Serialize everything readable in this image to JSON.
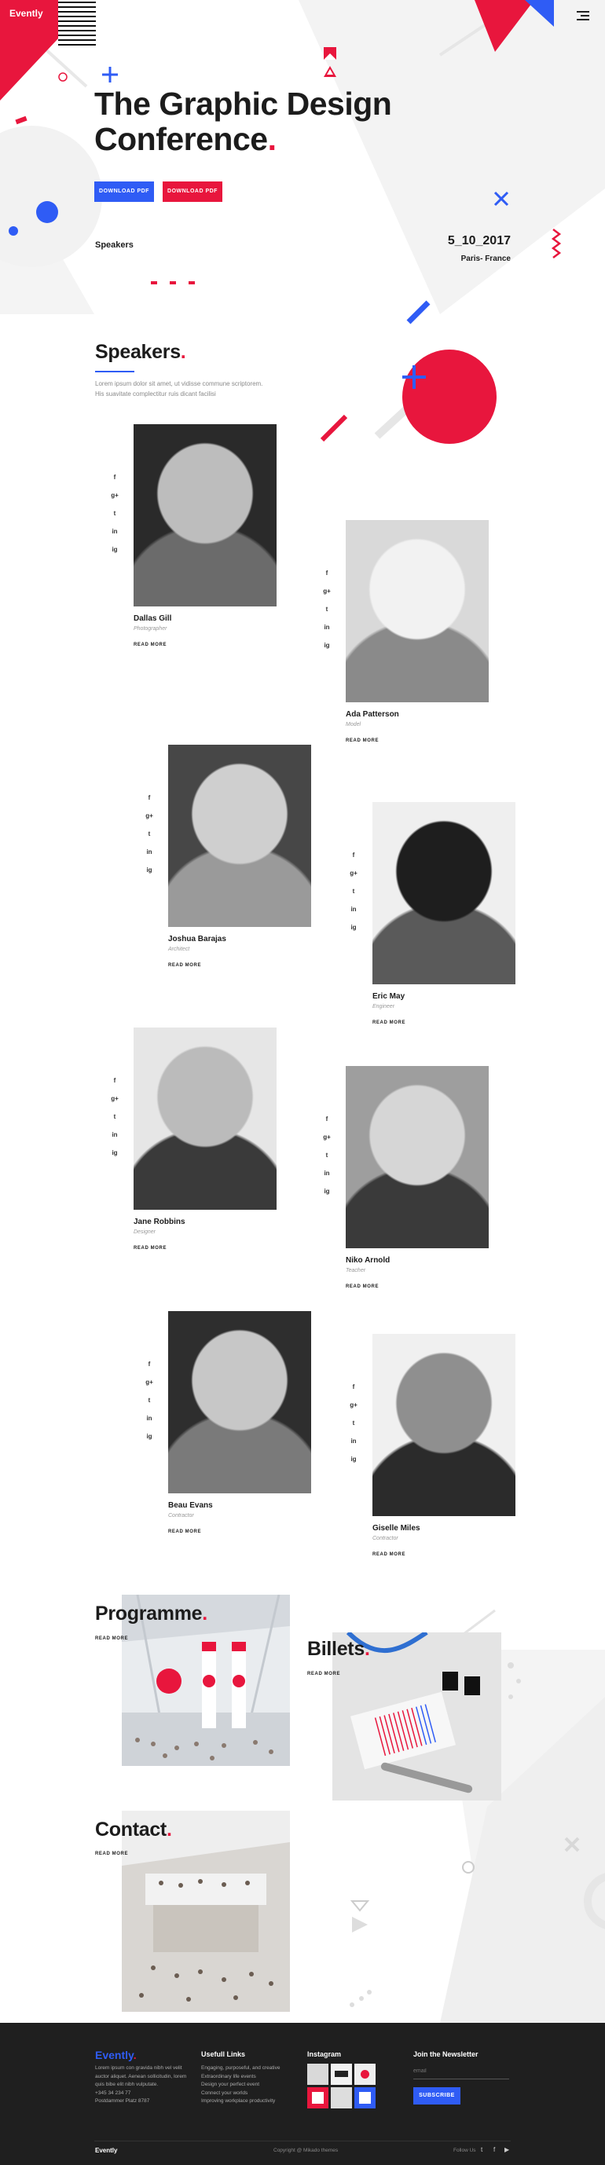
{
  "brand": {
    "logo": "Evently"
  },
  "hero": {
    "title_line1": "The Graphic Design",
    "title_line2": "Conference",
    "title_dot": ".",
    "btn_primary": "DOWNLOAD PDF",
    "btn_secondary": "DOWNLOAD PDF",
    "link": "Speakers",
    "date": "5_10_2017",
    "place": "Paris- France"
  },
  "speakers_section": {
    "title": "Speakers",
    "dot": ".",
    "text_line1": "Lorem ipsum dolor sit amet, ut vidisse commune scriptorem.",
    "text_line2": "His suavitate complectitur ruis dicant facilisi"
  },
  "social_icons": [
    "f",
    "g+",
    "t",
    "in",
    "ig"
  ],
  "speakers": [
    {
      "name": "Dallas Gill",
      "role": "Photographer",
      "more": "READ MORE"
    },
    {
      "name": "Ada Patterson",
      "role": "Model",
      "more": "READ MORE"
    },
    {
      "name": "Joshua Barajas",
      "role": "Architect",
      "more": "READ MORE"
    },
    {
      "name": "Eric May",
      "role": "Engineer",
      "more": "READ MORE"
    },
    {
      "name": "Jane Robbins",
      "role": "Designer",
      "more": "READ MORE"
    },
    {
      "name": "Niko Arnold",
      "role": "Teacher",
      "more": "READ MORE"
    },
    {
      "name": "Beau Evans",
      "role": "Contractor",
      "more": "READ MORE"
    },
    {
      "name": "Giselle Miles",
      "role": "Contractor",
      "more": "READ MORE"
    }
  ],
  "programme": {
    "title": "Programme",
    "dot": ".",
    "more": "READ MORE"
  },
  "billets": {
    "title": "Billets",
    "dot": ".",
    "more": "READ MORE"
  },
  "contact": {
    "title": "Contact",
    "dot": ".",
    "more": "READ MORE"
  },
  "footer": {
    "brand": "Evently",
    "brand_dot": ".",
    "about": [
      "Lorem ipsum con gravida nibh vel velit",
      "auctor aliquet. Aenean sollicitudin, lorem",
      "quis bibe elit nibh vulputate.",
      "+345 34 234 77",
      "Postdammer Platz 8787"
    ],
    "links_title": "Usefull Links",
    "links": [
      "Engaging, purposeful, and creative",
      "Extraordinary life events",
      "Design your perfect event",
      "Connect your worlds",
      "Improving workplace productivity"
    ],
    "instagram_title": "Instagram",
    "newsletter_title": "Join the Newsletter",
    "email_placeholder": "email",
    "subscribe": "SUBSCRIBE",
    "bottom_brand": "Evently",
    "copyright": "Copyright @ Mikado themes",
    "follow": "Follow Us"
  },
  "colors": {
    "red": "#e8163d",
    "blue": "#2f5cf5",
    "dark": "#1f1f1f"
  }
}
